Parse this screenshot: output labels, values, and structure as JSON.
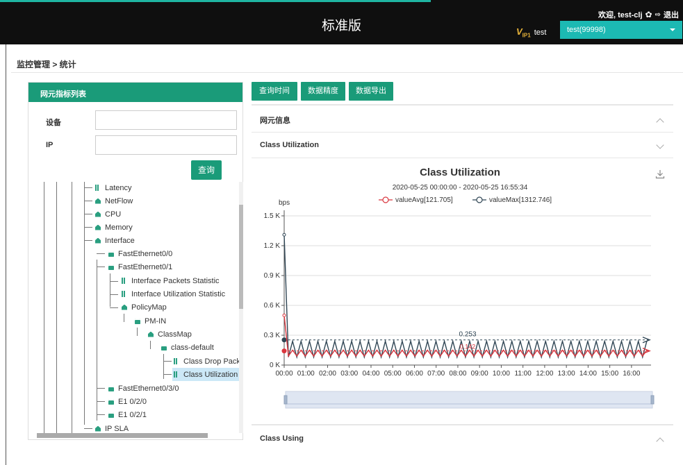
{
  "header": {
    "title": "标准版",
    "welcome": "欢迎, test-clj",
    "logout": "退出",
    "vip_label": "test",
    "vip_logo": "V",
    "tenant": "test(99998)"
  },
  "breadcrumb": "监控管理 > 统计",
  "left_panel": {
    "title": "网元指标列表",
    "device_label": "设备",
    "ip_label": "IP",
    "device_value": "",
    "ip_value": "",
    "query_button": "查询",
    "tree": [
      {
        "label": "Latency",
        "icon": "bar-chart-icon"
      },
      {
        "label": "NetFlow",
        "icon": "folder-icon"
      },
      {
        "label": "CPU",
        "icon": "folder-icon"
      },
      {
        "label": "Memory",
        "icon": "folder-icon"
      },
      {
        "label": "Interface",
        "icon": "folder-icon"
      },
      {
        "label": "FastEthernet0/0",
        "icon": "interface-icon"
      },
      {
        "label": "FastEthernet0/1",
        "icon": "interface-icon"
      },
      {
        "label": "Interface Packets Statistic",
        "icon": "bar-chart-icon"
      },
      {
        "label": "Interface Utilization Statistic",
        "icon": "bar-chart-icon"
      },
      {
        "label": "PolicyMap",
        "icon": "folder-icon"
      },
      {
        "label": "PM-IN",
        "icon": "interface-icon"
      },
      {
        "label": "ClassMap",
        "icon": "folder-icon"
      },
      {
        "label": "class-default",
        "icon": "interface-icon"
      },
      {
        "label": "Class Drop Packets",
        "icon": "bar-chart-icon"
      },
      {
        "label": "Class Utilization",
        "icon": "bar-chart-icon"
      },
      {
        "label": "FastEthernet0/3/0",
        "icon": "interface-icon"
      },
      {
        "label": "E1 0/2/0",
        "icon": "interface-icon"
      },
      {
        "label": "E1 0/2/1",
        "icon": "interface-icon"
      },
      {
        "label": "IP SLA",
        "icon": "folder-icon"
      }
    ]
  },
  "toolbar": {
    "query_time": "查询时间",
    "precision": "数据精度",
    "export": "数据导出"
  },
  "sections": {
    "ne_info": "网元信息",
    "class_util": "Class Utilization",
    "class_using": "Class Using"
  },
  "colors": {
    "accent": "#1a9b79",
    "avg_series": "#d9363e",
    "max_series": "#2f4554"
  },
  "chart_data": {
    "type": "line",
    "title": "Class Utilization",
    "subtitle": "2020-05-25 00:00:00 - 2020-05-25 16:55:34",
    "ylabel": "bps",
    "ylim": [
      0,
      1.5
    ],
    "yticks": [
      "0 K",
      "0.3 K",
      "0.6 K",
      "0.9 K",
      "1.2 K",
      "1.5 K"
    ],
    "xticks": [
      "00:00",
      "01:00",
      "02:00",
      "03:00",
      "04:00",
      "05:00",
      "06:00",
      "07:00",
      "08:00",
      "09:00",
      "10:00",
      "11:00",
      "12:00",
      "13:00",
      "14:00",
      "15:00",
      "16:00"
    ],
    "series": [
      {
        "name": "valueAvg[121.705]",
        "start": 0.5,
        "low": 0.09,
        "high": 0.15,
        "markline": 0.142
      },
      {
        "name": "valueMax[1312.746]",
        "start": 1.31,
        "low": 0.08,
        "high": 0.24,
        "markline": 0.253
      }
    ],
    "markline_label": "0.253",
    "markline_label_avg": "0.142",
    "grid": true,
    "legend": "top-center"
  }
}
